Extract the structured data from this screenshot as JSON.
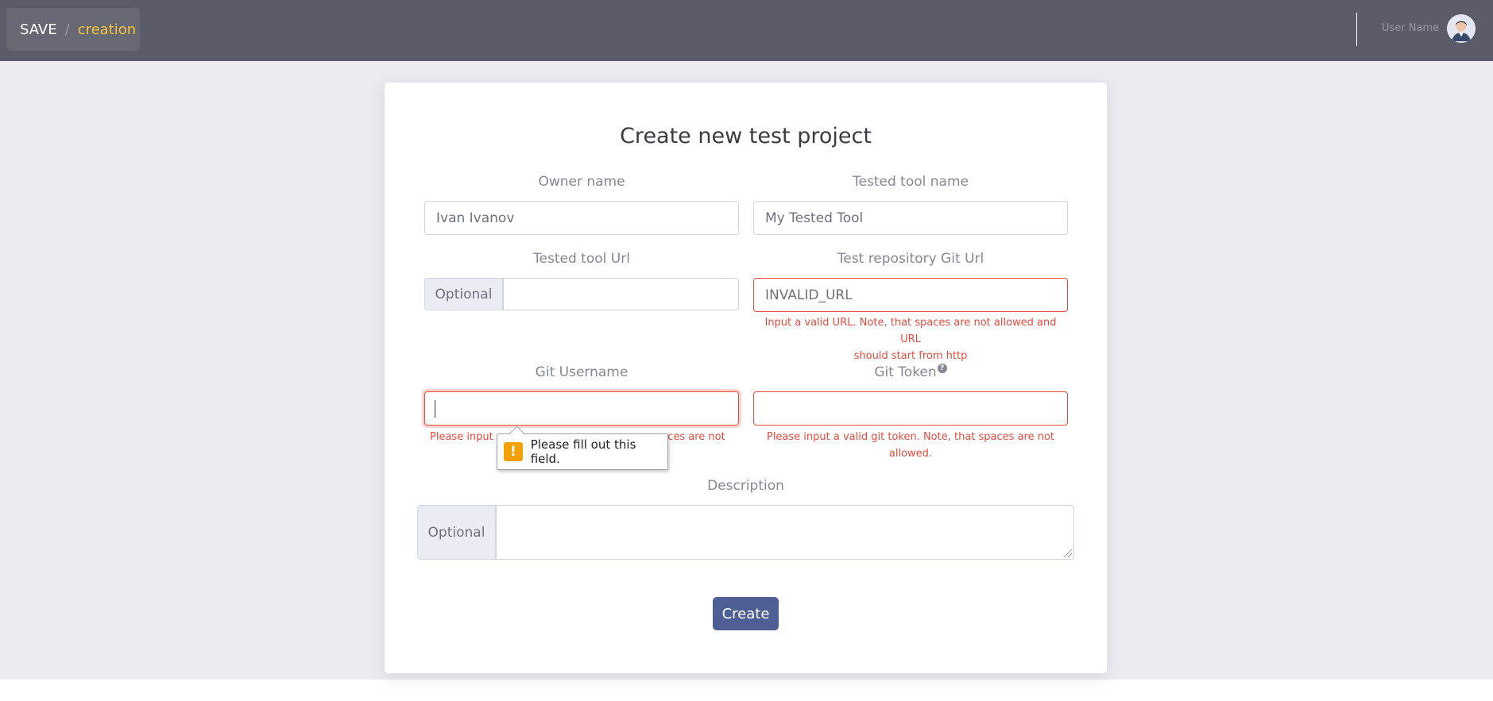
{
  "header": {
    "breadcrumb_root": "SAVE",
    "breadcrumb_separator": "/",
    "breadcrumb_current": "creation",
    "user_name": "User Name"
  },
  "form": {
    "title": "Create new test project",
    "owner_name": {
      "label": "Owner name",
      "value": "Ivan Ivanov"
    },
    "tested_tool_name": {
      "label": "Tested tool name",
      "value": "My Tested Tool"
    },
    "tested_tool_url": {
      "label": "Tested tool Url",
      "addon": "Optional",
      "value": ""
    },
    "git_url": {
      "label": "Test repository Git Url",
      "value": "INVALID_URL",
      "error_line1": "Input a valid URL. Note, that spaces are not allowed and URL",
      "error_line2": "should start from http"
    },
    "git_username": {
      "label": "Git Username",
      "value": "",
      "error_visible_left": "Please input",
      "error_visible_right": "paces are not"
    },
    "git_token": {
      "label": "Git Token",
      "help_icon": "?",
      "value": "",
      "error_line1": "Please input a valid git token. Note, that spaces are not",
      "error_line2": "allowed."
    },
    "description": {
      "label": "Description",
      "addon": "Optional",
      "value": ""
    },
    "create_label": "Create"
  },
  "tooltip": {
    "icon": "!",
    "message": "Please fill out this field."
  },
  "colors": {
    "topbar": "#5a5c69",
    "accent": "#f6c23e",
    "error": "#e74a3b",
    "button": "#4e5f96"
  }
}
